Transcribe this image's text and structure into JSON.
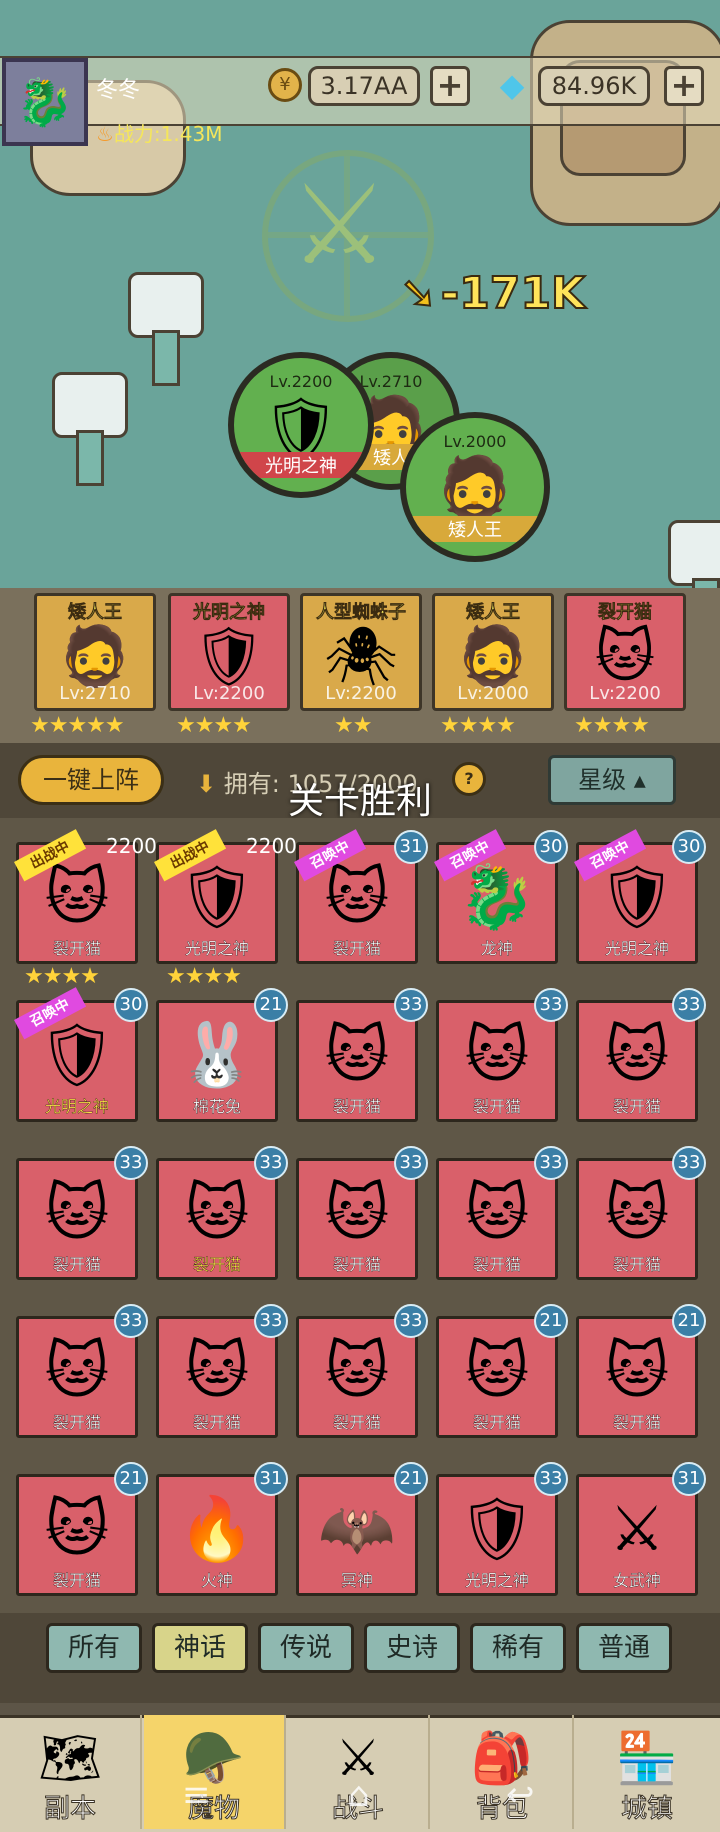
{
  "header": {
    "player_name": "冬冬",
    "power": "战力:1.43M",
    "gold": "3.17AA",
    "diamonds": "84.96K",
    "plus": "+"
  },
  "battle": {
    "damage": "-171K",
    "formation": [
      {
        "level": "Lv.2200",
        "name": "光明之神"
      },
      {
        "level": "Lv.2710",
        "name": "矮人"
      },
      {
        "level": "Lv.2000",
        "name": "矮人王"
      }
    ]
  },
  "team": [
    {
      "name": "矮人王",
      "level": "Lv:2710",
      "stars": "★★★★★"
    },
    {
      "name": "光明之神",
      "level": "Lv:2200",
      "stars": "★★★★"
    },
    {
      "name": "人型蜘蛛子",
      "level": "Lv:2200",
      "stars": "★★"
    },
    {
      "name": "矮人王",
      "level": "Lv:2000",
      "stars": "★★★★"
    },
    {
      "name": "裂开猫",
      "level": "Lv:2200",
      "stars": "★★★★"
    }
  ],
  "controls": {
    "one_click": "一键上阵",
    "owned": "拥有: 1057/2000",
    "help": "?",
    "sort": "星级"
  },
  "toast": "关卡胜利",
  "tags": {
    "fighting": "出战中",
    "summoning": "召唤中"
  },
  "grid": [
    {
      "name": "裂开猫",
      "level": "2200",
      "tag": "出战中",
      "stars": "★★★★"
    },
    {
      "name": "光明之神",
      "level": "2200",
      "tag": "出战中",
      "stars": "★★★★"
    },
    {
      "name": "裂开猫",
      "level": "31",
      "tag": "召唤中"
    },
    {
      "name": "龙神",
      "level": "30",
      "tag": "召唤中"
    },
    {
      "name": "光明之神",
      "level": "30",
      "tag": "召唤中"
    },
    {
      "name": "光明之神",
      "level": "30",
      "tag": "召唤中"
    },
    {
      "name": "棉花兔",
      "level": "21"
    },
    {
      "name": "裂开猫",
      "level": "33"
    },
    {
      "name": "裂开猫",
      "level": "33"
    },
    {
      "name": "裂开猫",
      "level": "33"
    },
    {
      "name": "裂开猫",
      "level": "33"
    },
    {
      "name": "裂开猫",
      "level": "33"
    },
    {
      "name": "裂开猫",
      "level": "33"
    },
    {
      "name": "裂开猫",
      "level": "33"
    },
    {
      "name": "裂开猫",
      "level": "33"
    },
    {
      "name": "裂开猫",
      "level": "33"
    },
    {
      "name": "裂开猫",
      "level": "33"
    },
    {
      "name": "裂开猫",
      "level": "33"
    },
    {
      "name": "裂开猫",
      "level": "21"
    },
    {
      "name": "裂开猫",
      "level": "21"
    },
    {
      "name": "裂开猫",
      "level": "21"
    },
    {
      "name": "火神",
      "level": "31"
    },
    {
      "name": "冥神",
      "level": "21"
    },
    {
      "name": "光明之神",
      "level": "33"
    },
    {
      "name": "女武神",
      "level": "31"
    }
  ],
  "filters": [
    "所有",
    "神话",
    "传说",
    "史诗",
    "稀有",
    "普通"
  ],
  "nav": [
    "副本",
    "魔物",
    "战斗",
    "背包",
    "城镇"
  ],
  "colors": {
    "card": "#d9606a",
    "card_gold": "#d9a94a",
    "badge": "#3b7fa6",
    "active_filter": "#d8d48a",
    "active_nav": "#f5d46a"
  }
}
